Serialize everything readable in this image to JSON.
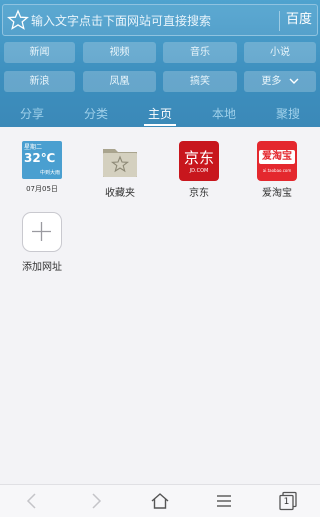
{
  "search": {
    "placeholder": "输入文字点击下面网站可直接搜索",
    "engine_label": "百度"
  },
  "quick_links": [
    "新闻",
    "视频",
    "音乐",
    "小说",
    "新浪",
    "凤凰",
    "搞笑",
    "更多"
  ],
  "tabs": [
    "分享",
    "分类",
    "主页",
    "本地",
    "聚搜"
  ],
  "active_tab": "主页",
  "weather": {
    "weekday": "星期二",
    "temperature": "32℃",
    "condition": "中到大雨",
    "date": "07月05日"
  },
  "shortcuts": [
    {
      "label": "收藏夹"
    },
    {
      "label": "京东",
      "logo_text": "京东",
      "logo_sub": "JD.COM"
    },
    {
      "label": "爱淘宝",
      "logo_text": "爱淘宝",
      "logo_sub": "ai.taobao.com"
    }
  ],
  "add_shortcut_label": "添加网址",
  "tab_count": "1",
  "colors": {
    "header": "#3d8fbe",
    "jd_red": "#c8161d",
    "taobao_red": "#e4282e",
    "weather_blue": "#4a9fd0"
  }
}
